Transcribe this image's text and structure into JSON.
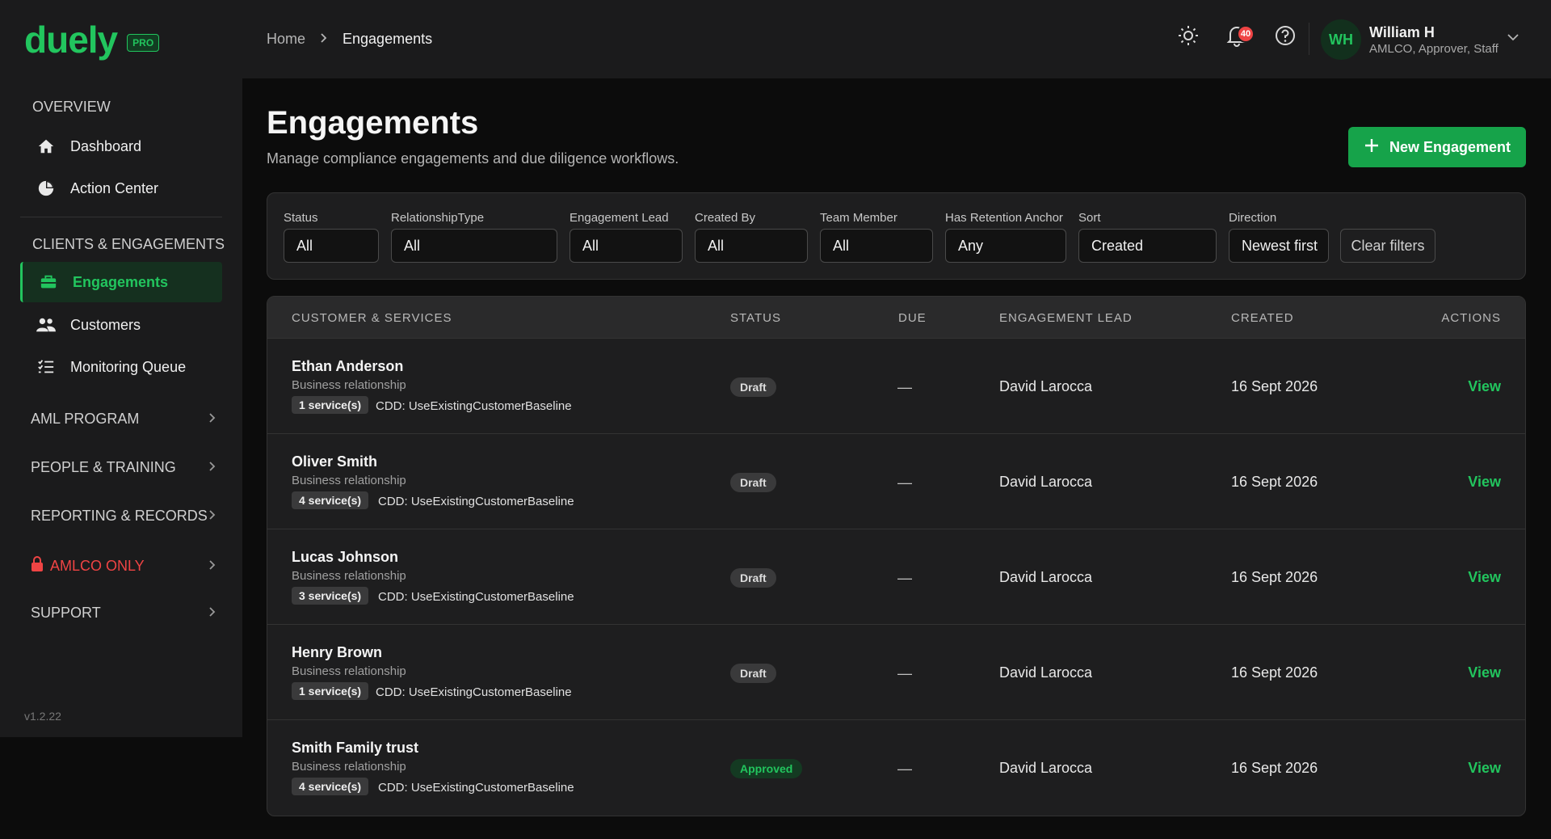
{
  "brand": {
    "logo": "duely",
    "badge": "PRO",
    "version": "v1.2.22"
  },
  "sidebar": {
    "overview_label": "OVERVIEW",
    "overview_items": [
      {
        "label": "Dashboard",
        "icon": "home-icon"
      },
      {
        "label": "Action Center",
        "icon": "pie-chart-icon"
      }
    ],
    "clients_label": "CLIENTS & ENGAGEMENTS",
    "clients_items": [
      {
        "label": "Engagements",
        "icon": "briefcase-icon",
        "active": true
      },
      {
        "label": "Customers",
        "icon": "users-icon"
      },
      {
        "label": "Monitoring Queue",
        "icon": "list-check-icon"
      }
    ],
    "groups": [
      {
        "label": "AML PROGRAM"
      },
      {
        "label": "PEOPLE & TRAINING"
      },
      {
        "label": "REPORTING & RECORDS"
      },
      {
        "label": "AMLCO ONLY",
        "danger": true,
        "icon": "lock-icon"
      },
      {
        "label": "SUPPORT"
      }
    ]
  },
  "topbar": {
    "breadcrumb": [
      "Home",
      "Engagements"
    ],
    "notification_count": "40",
    "user": {
      "initials": "WH",
      "name": "William H",
      "role": "AMLCO, Approver, Staff"
    }
  },
  "page": {
    "title": "Engagements",
    "subtitle": "Manage compliance engagements and due diligence workflows.",
    "new_button": "New Engagement"
  },
  "filters": {
    "status": {
      "label": "Status",
      "value": "All"
    },
    "relationship_type": {
      "label": "RelationshipType",
      "value": "All"
    },
    "engagement_lead": {
      "label": "Engagement Lead",
      "value": "All"
    },
    "created_by": {
      "label": "Created By",
      "value": "All"
    },
    "team_member": {
      "label": "Team Member",
      "value": "All"
    },
    "retention_anchor": {
      "label": "Has Retention Anchor",
      "value": "Any"
    },
    "sort": {
      "label": "Sort",
      "value": "Created"
    },
    "direction": {
      "label": "Direction",
      "value": "Newest first"
    },
    "clear_label": "Clear filters"
  },
  "table": {
    "headers": {
      "customer": "CUSTOMER & SERVICES",
      "status": "STATUS",
      "due": "DUE",
      "lead": "ENGAGEMENT LEAD",
      "created": "CREATED",
      "actions": "ACTIONS"
    },
    "rows": [
      {
        "name": "Ethan Anderson",
        "type": "Business relationship",
        "services": "1 service(s)",
        "cdd": "CDD: UseExistingCustomerBaseline",
        "status": "Draft",
        "due": "—",
        "lead": "David Larocca",
        "created": "16 Sept 2026",
        "action": "View"
      },
      {
        "name": "Oliver Smith",
        "type": "Business relationship",
        "services": "4 service(s)",
        "cdd": "CDD: UseExistingCustomerBaseline",
        "status": "Draft",
        "due": "—",
        "lead": "David Larocca",
        "created": "16 Sept 2026",
        "action": "View"
      },
      {
        "name": "Lucas Johnson",
        "type": "Business relationship",
        "services": "3 service(s)",
        "cdd": "CDD: UseExistingCustomerBaseline",
        "status": "Draft",
        "due": "—",
        "lead": "David Larocca",
        "created": "16 Sept 2026",
        "action": "View"
      },
      {
        "name": "Henry Brown",
        "type": "Business relationship",
        "services": "1 service(s)",
        "cdd": "CDD: UseExistingCustomerBaseline",
        "status": "Draft",
        "due": "—",
        "lead": "David Larocca",
        "created": "16 Sept 2026",
        "action": "View"
      },
      {
        "name": "Smith Family trust",
        "type": "Business relationship",
        "services": "4 service(s)",
        "cdd": "CDD: UseExistingCustomerBaseline",
        "status": "Approved",
        "due": "—",
        "lead": "David Larocca",
        "created": "16 Sept 2026",
        "action": "View"
      }
    ]
  },
  "colors": {
    "accent": "#22c55e",
    "danger": "#ef4444",
    "background": "#0c0c0c",
    "panel": "#1e1e1f"
  }
}
